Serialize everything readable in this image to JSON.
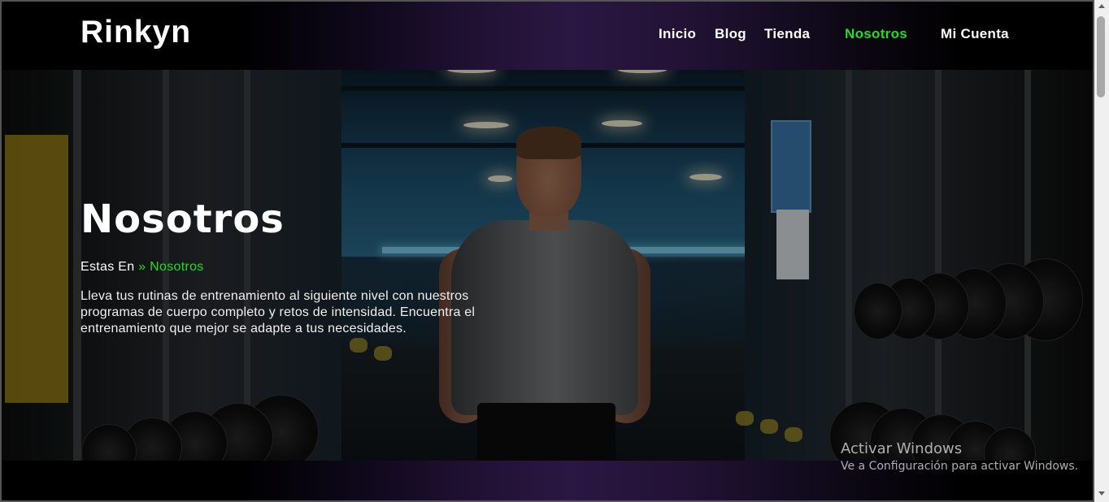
{
  "header": {
    "logo": "Rinkyn",
    "nav": [
      {
        "label": "Inicio"
      },
      {
        "label": "Blog"
      },
      {
        "label": "Tienda"
      },
      {
        "label": "Nosotros",
        "active": true
      },
      {
        "label": "Mi Cuenta"
      }
    ]
  },
  "hero": {
    "title": "Nosotros",
    "breadcrumb": {
      "prefix": "Estas En",
      "separator": "»",
      "current": "Nosotros"
    },
    "description": "Lleva tus rutinas de entrenamiento al siguiente nivel con nuestros programas de cuerpo completo y retos de intensidad. Encuentra el entrenamiento que mejor se adapte a tus necesidades."
  },
  "watermark": {
    "title": "Activar Windows",
    "subtitle": "Ve a Configuración para activar Windows."
  },
  "colors": {
    "accent": "#22dd22",
    "header_purple": "#2a1742"
  }
}
